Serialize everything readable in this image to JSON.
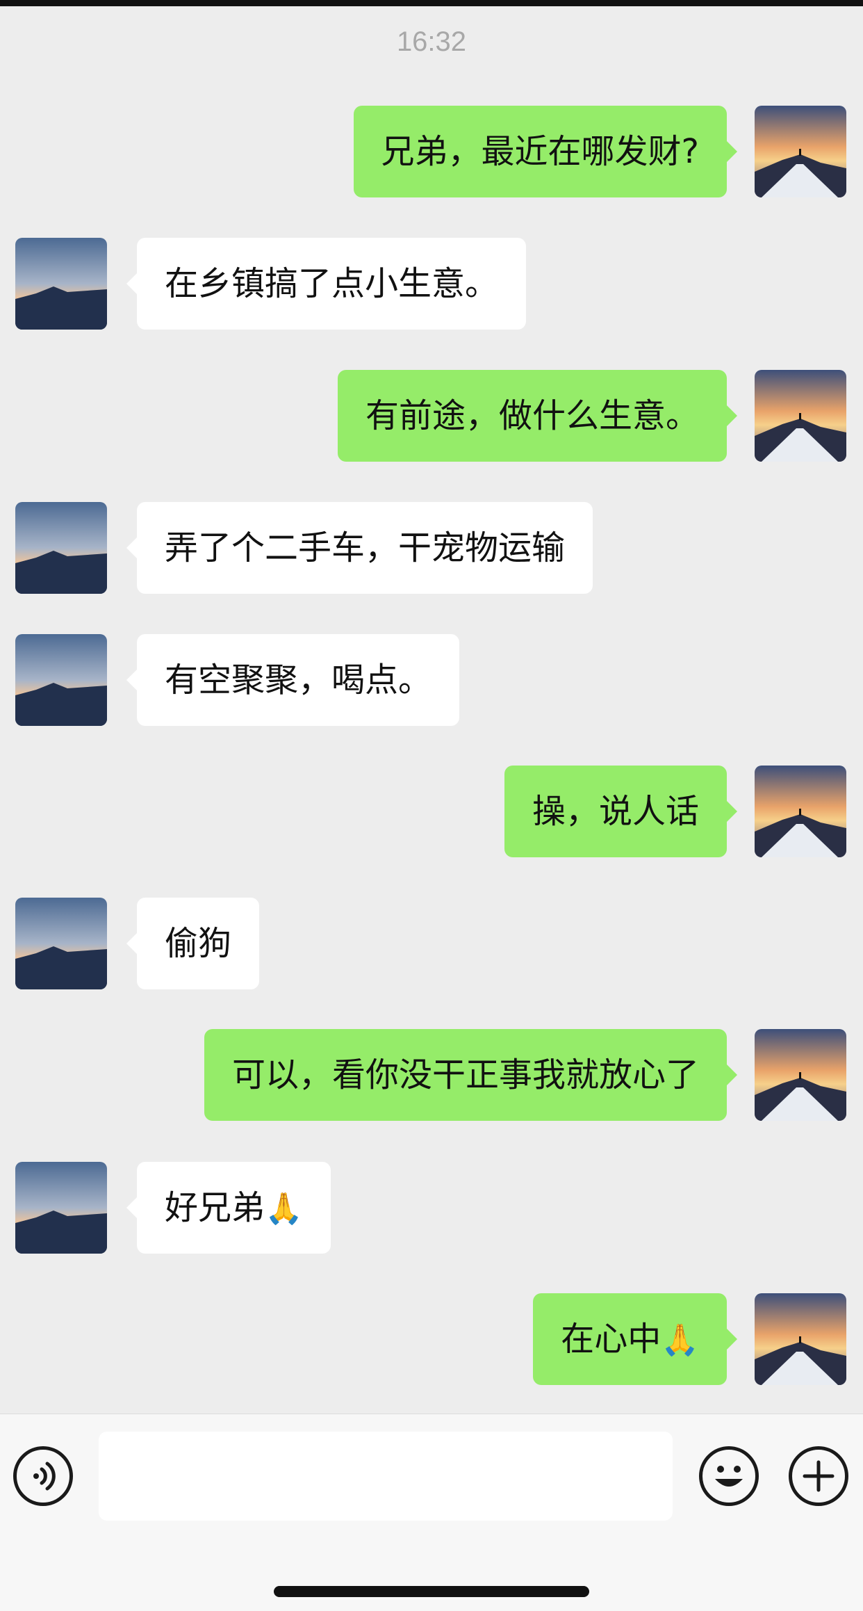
{
  "status": {
    "time": "16:32"
  },
  "messages": [
    {
      "side": "me",
      "text": "兄弟，最近在哪发财?"
    },
    {
      "side": "other",
      "text": "在乡镇搞了点小生意。"
    },
    {
      "side": "me",
      "text": "有前途，做什么生意。"
    },
    {
      "side": "other",
      "text": "弄了个二手车，干宠物运输"
    },
    {
      "side": "other",
      "text": "有空聚聚，喝点。"
    },
    {
      "side": "me",
      "text": "操，说人话"
    },
    {
      "side": "other",
      "text": "偷狗"
    },
    {
      "side": "me",
      "text": "可以，看你没干正事我就放心了"
    },
    {
      "side": "other",
      "text": "好兄弟",
      "emoji": "🙏"
    },
    {
      "side": "me",
      "text": "在心中",
      "emoji": "🙏"
    }
  ],
  "input": {
    "value": ""
  },
  "icons": {
    "voice": "voice-icon",
    "emoji": "emoji-face-icon",
    "plus": "plus-icon"
  },
  "colors": {
    "background": "#ededed",
    "my_bubble": "#95ec69",
    "other_bubble": "#ffffff",
    "timestamp": "#a8a8a8"
  }
}
